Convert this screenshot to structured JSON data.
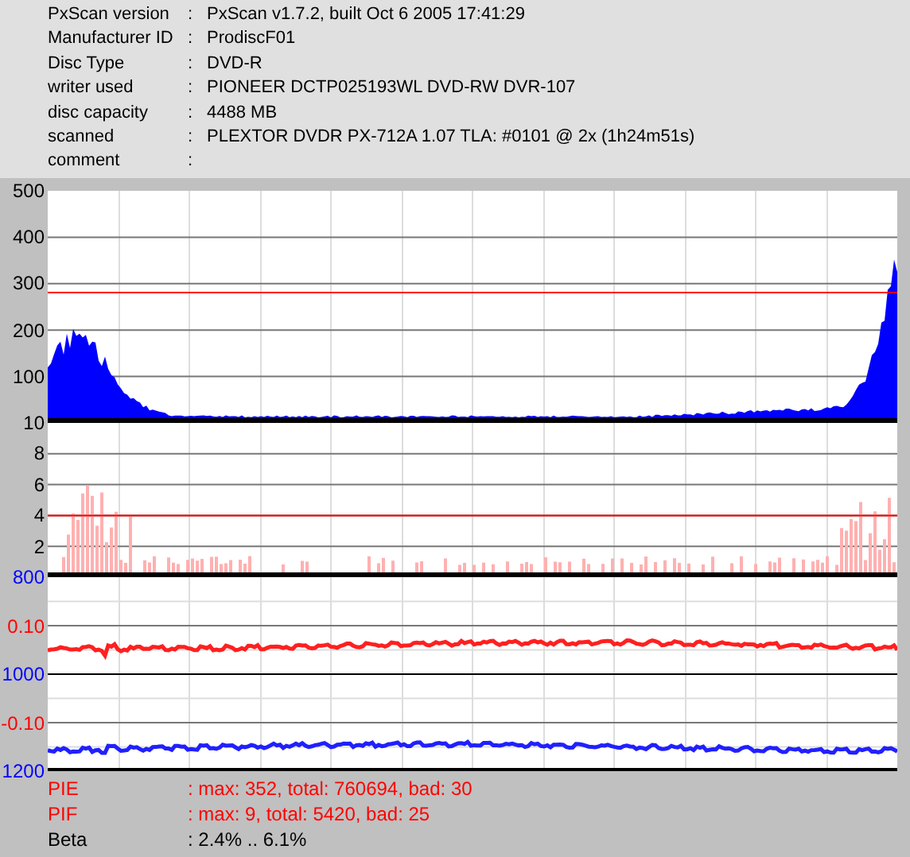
{
  "info": [
    {
      "label": "PxScan version",
      "sep": ":",
      "value": "PxScan v1.7.2, built Oct  6 2005 17:41:29"
    },
    {
      "label": "Manufacturer ID",
      "sep": ":",
      "value": "ProdiscF01"
    },
    {
      "label": "Disc Type",
      "sep": ":",
      "value": "DVD-R"
    },
    {
      "label": "writer used",
      "sep": ":",
      "value": "PIONEER DCTP025193WL DVD-RW DVR-107"
    },
    {
      "label": "disc capacity",
      "sep": ":",
      "value": "4488 MB"
    },
    {
      "label": "scanned",
      "sep": ":",
      "value": "PLEXTOR DVDR PX-712A 1.07 TLA: #0101 @ 2x (1h24m51s)"
    },
    {
      "label": "comment",
      "sep": ":"
    }
  ],
  "panels": [
    {
      "kind": "pie",
      "labels": [
        {
          "text": "500",
          "color": "#000000"
        },
        {
          "text": "400",
          "color": "#000000"
        },
        {
          "text": "300",
          "color": "#000000"
        },
        {
          "text": "200",
          "color": "#000000"
        },
        {
          "text": "100",
          "color": "#000000"
        },
        {
          "text": "10",
          "color": "#000000"
        }
      ]
    },
    {
      "kind": "pif",
      "labels": [
        {
          "text": "8",
          "color": "#000000"
        },
        {
          "text": "6",
          "color": "#000000"
        },
        {
          "text": "4",
          "color": "#000000"
        },
        {
          "text": "2",
          "color": "#000000"
        },
        {
          "text": "800",
          "color": "#0000ff"
        }
      ]
    },
    {
      "kind": "beta",
      "labels": [
        {
          "text": "0.10",
          "color": "#ff0000"
        },
        {
          "text": "1000",
          "color": "#0000ff"
        },
        {
          "text": "-0.10",
          "color": "#ff0000"
        },
        {
          "text": "1200",
          "color": "#0000ff"
        }
      ]
    }
  ],
  "summary": [
    {
      "name": "PIE",
      "value": ": max: 352, total: 760694, bad: 30",
      "color": "#ff0000"
    },
    {
      "name": "PIF",
      "value": ": max: 9, total: 5420, bad: 25",
      "color": "#ff0000"
    },
    {
      "name": "Beta",
      "value": ": 2.4% .. 6.1%",
      "color": "#000000"
    }
  ]
}
